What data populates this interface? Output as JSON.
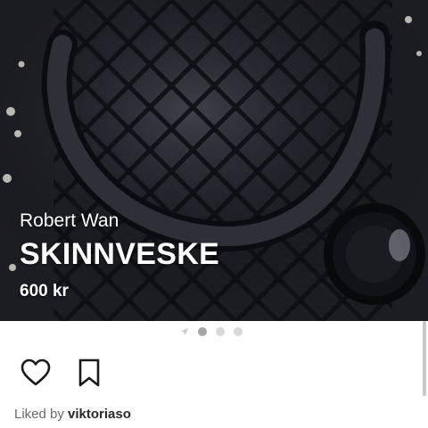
{
  "listing": {
    "brand": "Robert Wan",
    "title": "SKINNVESKE",
    "price": "600 kr"
  },
  "carousel": {
    "image_count": 4,
    "active_index": 1,
    "first_icon": "location-arrow-icon"
  },
  "actions": {
    "like_icon": "heart-icon",
    "save_icon": "bookmark-icon"
  },
  "likes": {
    "prefix": "Liked by",
    "user": "viktoriaso"
  },
  "colors": {
    "overlay_text": "#ffffff",
    "dot_active": "#a6a6a6",
    "dot_inactive": "#d9d9d9",
    "liked_text": "#6b6b6b"
  }
}
